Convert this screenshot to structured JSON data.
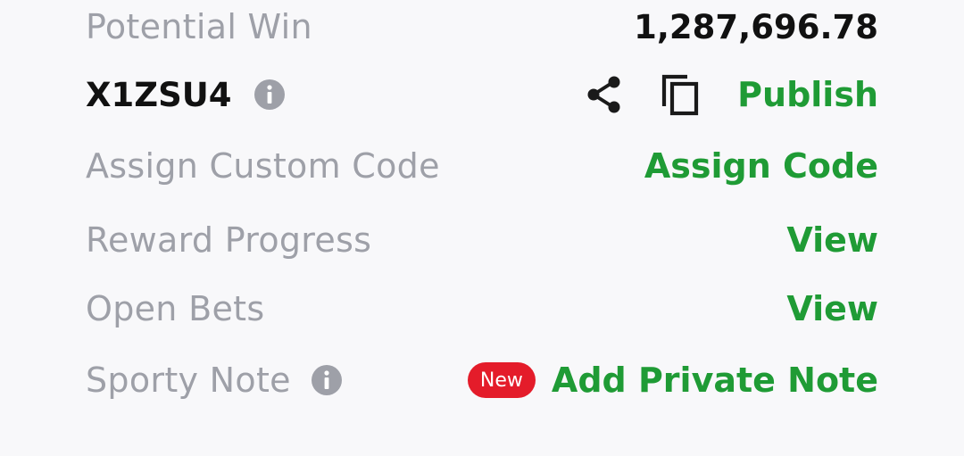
{
  "potential_win": {
    "label": "Potential Win",
    "value": "1,287,696.78"
  },
  "booking": {
    "code": "X1ZSU4",
    "info_icon": "info-icon",
    "share_icon": "share-icon",
    "copy_icon": "copy-icon",
    "publish_label": "Publish"
  },
  "custom_code": {
    "label": "Assign Custom Code",
    "action_label": "Assign Code"
  },
  "reward_progress": {
    "label": "Reward Progress",
    "action_label": "View"
  },
  "open_bets": {
    "label": "Open Bets",
    "action_label": "View"
  },
  "sporty_note": {
    "label": "Sporty Note",
    "info_icon": "info-icon",
    "badge": "New",
    "action_label": "Add Private Note"
  },
  "colors": {
    "background": "#f8f8fa",
    "label_gray": "#9ea0a8",
    "text_dark": "#111111",
    "action_green": "#1f9b35",
    "badge_red": "#e41c2a"
  }
}
